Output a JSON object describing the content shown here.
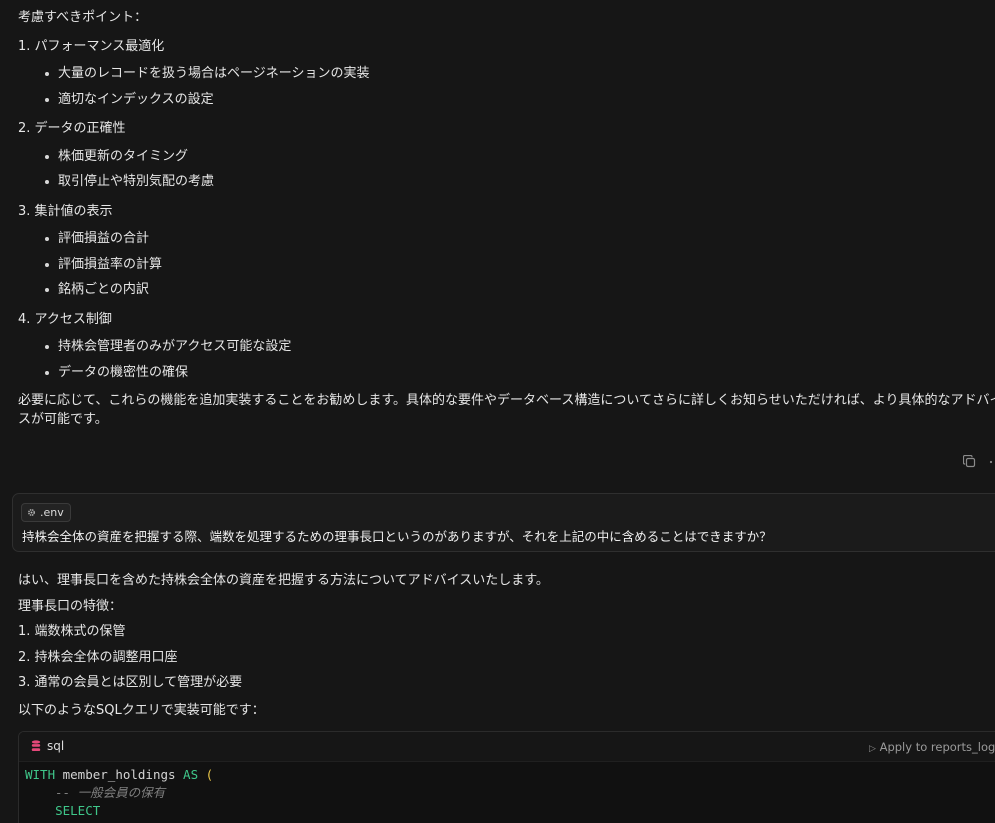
{
  "assistant_message_1": {
    "heading": "考慮すべきポイント：",
    "sections": [
      {
        "title": "1. パフォーマンス最適化",
        "bullets": [
          "大量のレコードを扱う場合はページネーションの実装",
          "適切なインデックスの設定"
        ]
      },
      {
        "title": "2. データの正確性",
        "bullets": [
          "株価更新のタイミング",
          "取引停止や特別気配の考慮"
        ]
      },
      {
        "title": "3. 集計値の表示",
        "bullets": [
          "評価損益の合計",
          "評価損益率の計算",
          "銘柄ごとの内訳"
        ]
      },
      {
        "title": "4. アクセス制御",
        "bullets": [
          "持株会管理者のみがアクセス可能な設定",
          "データの機密性の確保"
        ]
      }
    ],
    "closing_line1": "必要に応じて、これらの機能を追加実装することをお勧めします。具体的な要件やデータベース構造についてさらに詳しくお知らせいただければ、より具体的なアドバイ",
    "closing_line2": "スが可能です。"
  },
  "message_actions": {
    "copy_icon": "copy-icon"
  },
  "user_message": {
    "attachment": ".env",
    "attachment_icon": "gear-icon",
    "text": "持株会全体の資産を把握する際、端数を処理するための理事長口というのがありますが、それを上記の中に含めることはできますか？"
  },
  "assistant_message_2": {
    "intro": "はい、理事長口を含めた持株会全体の資産を把握する方法についてアドバイスいたします。",
    "features_heading": "理事長口の特徴：",
    "features": [
      "1. 端数株式の保管",
      "2. 持株会全体の調整用口座",
      "3. 通常の会員とは区別して管理が必要"
    ],
    "sql_intro": "以下のようなSQLクエリで実装可能です：",
    "code_block": {
      "language": "sql",
      "apply_label": "Apply to reports_logi...",
      "lines": {
        "l1_kw1": "WITH",
        "l1_ident": " member_holdings ",
        "l1_kw2": "AS",
        "l1_paren": " (",
        "l2_comment": "-- 一般会員の保有",
        "l3_kw": "SELECT"
      }
    }
  },
  "colors": {
    "background": "#161616",
    "text": "#e6e6e6",
    "keyword": "#3fc78a",
    "paren": "#e8c547",
    "comment": "#7f7f7f",
    "db_icon": "#e5487a"
  }
}
